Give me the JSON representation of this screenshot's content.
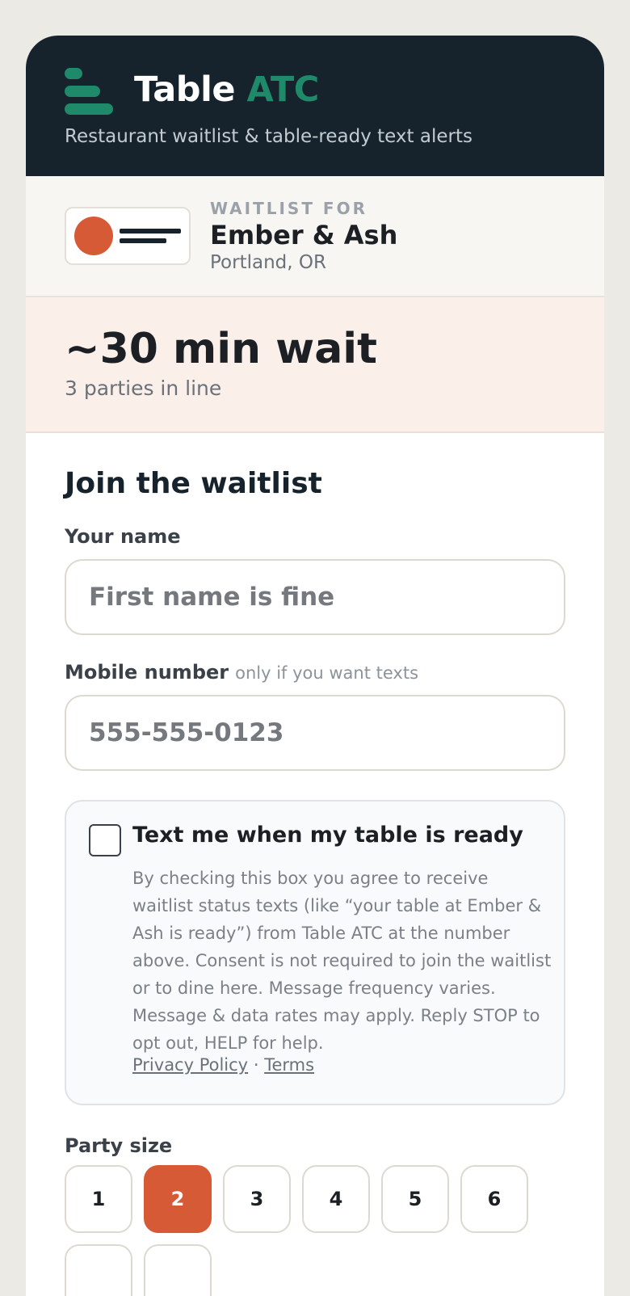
{
  "brand": {
    "name_main": "Table",
    "name_accent": "ATC",
    "tagline": "Restaurant waitlist & table-ready text alerts",
    "accent_color": "#1f8a6a"
  },
  "venue": {
    "kicker": "WAITLIST FOR",
    "name": "Ember & Ash",
    "location": "Portland, OR"
  },
  "wait": {
    "estimate": "~30 min wait",
    "parties": "3 parties in line"
  },
  "form": {
    "title": "Join the waitlist",
    "name_label": "Your name",
    "name_placeholder": "First name is fine",
    "phone_label": "Mobile number",
    "phone_hint": "only if you want texts",
    "phone_placeholder": "555-555-0123",
    "consent_title": "Text me when my table is ready",
    "consent_text": "By checking this box you agree to receive waitlist status texts (like “your table at Ember & Ash is ready”) from Table ATC at the number above. Consent is not required to join the waitlist or to dine here. Message frequency varies. Message & data rates may apply. Reply STOP to opt out, HELP for help.",
    "privacy_link": "Privacy Policy",
    "link_separator": "·",
    "terms_link": "Terms",
    "consent_checked": false,
    "party_label": "Party size",
    "party_sizes": [
      "1",
      "2",
      "3",
      "4",
      "5",
      "6"
    ],
    "party_selected": "2",
    "selected_color": "#d65a35"
  }
}
